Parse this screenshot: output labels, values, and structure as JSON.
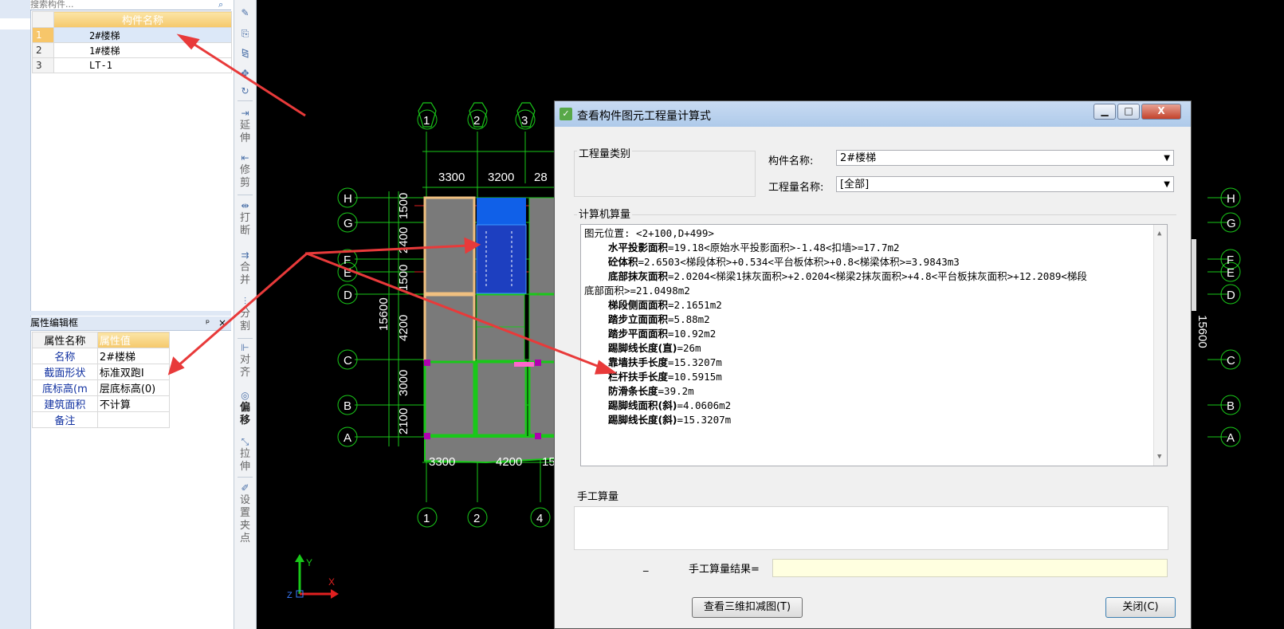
{
  "left_panel": {
    "search_placeholder": "搜索构件...",
    "component_table": {
      "header": "构件名称",
      "rows": [
        {
          "num": "1",
          "name": "2#楼梯",
          "selected": true
        },
        {
          "num": "2",
          "name": "1#楼梯",
          "selected": false
        },
        {
          "num": "3",
          "name": "LT-1",
          "selected": false
        }
      ]
    },
    "property_panel": {
      "title": "属性编辑框",
      "pin": "ᵖ",
      "close": "×",
      "header_name": "属性名称",
      "header_value": "属性值",
      "rows": [
        {
          "key": "名称",
          "value": "2#楼梯"
        },
        {
          "key": "截面形状",
          "value": "标准双跑I"
        },
        {
          "key": "底标高(m",
          "value": "层底标高(0)"
        },
        {
          "key": "建筑面积",
          "value": "不计算"
        },
        {
          "key": "备注",
          "value": ""
        }
      ]
    }
  },
  "toolbar": {
    "extend": "延伸",
    "trim": "修剪",
    "break": "打断",
    "merge": "合并",
    "split": "分割",
    "align": "对齐",
    "offset": "偏移",
    "stretch": "拉伸",
    "grip": "设置夹点"
  },
  "cad": {
    "axis_top": [
      "1",
      "2",
      "3"
    ],
    "axis_bottom": [
      "1",
      "2",
      "4"
    ],
    "axis_left": [
      "H",
      "G",
      "F",
      "E",
      "D",
      "C",
      "B",
      "A"
    ],
    "axis_right": [
      "H",
      "G",
      "F",
      "E",
      "D",
      "C",
      "B",
      "A"
    ],
    "dim_top": [
      "3300",
      "3200",
      "28"
    ],
    "dim_bottom": [
      "3300",
      "4200",
      "15"
    ],
    "dim_left_total": "15600",
    "dim_right_total": "15600",
    "dim_left": [
      "1500",
      "2400",
      "1500",
      "4200",
      "3000",
      "2100"
    ],
    "ucs_y": "Y",
    "ucs_x": "X",
    "ucs_z": "Z"
  },
  "dialog": {
    "title": "查看构件图元工程量计算式",
    "window_buttons": {
      "minimize": "▁",
      "maximize": "□",
      "close": "X"
    },
    "quantity_type_label": "工程量类别",
    "component_name_label": "构件名称:",
    "component_name_value": "2#楼梯",
    "quantity_name_label": "工程量名称:",
    "quantity_name_value": "[全部]",
    "computer_calc_label": "计算机算量",
    "calc_lines": [
      {
        "indent": false,
        "term": "",
        "text": "图元位置: <2+100,D+499>"
      },
      {
        "indent": true,
        "term": "水平投影面积",
        "text": "=19.18<原始水平投影面积>-1.48<扣墙>=17.7m2"
      },
      {
        "indent": true,
        "term": "砼体积",
        "text": "=2.6503<梯段体积>+0.534<平台板体积>+0.8<梯梁体积>=3.9843m3"
      },
      {
        "indent": true,
        "term": "底部抹灰面积",
        "text": "=2.0204<梯梁1抹灰面积>+2.0204<梯梁2抹灰面积>+4.8<平台板抹灰面积>+12.2089<梯段"
      },
      {
        "indent": false,
        "term": "",
        "text": "底部面积>=21.0498m2"
      },
      {
        "indent": true,
        "term": "梯段侧面面积",
        "text": "=2.1651m2"
      },
      {
        "indent": true,
        "term": "踏步立面面积",
        "text": "=5.88m2"
      },
      {
        "indent": true,
        "term": "踏步平面面积",
        "text": "=10.92m2"
      },
      {
        "indent": true,
        "term": "踢脚线长度(直)",
        "text": "=26m"
      },
      {
        "indent": true,
        "term": "靠墙扶手长度",
        "text": "=15.3207m"
      },
      {
        "indent": true,
        "term": "栏杆扶手长度",
        "text": "=10.5915m"
      },
      {
        "indent": true,
        "term": "防滑条长度",
        "text": "=39.2m"
      },
      {
        "indent": true,
        "term": "踢脚线面积(斜)",
        "text": "=4.0606m2"
      },
      {
        "indent": true,
        "term": "踢脚线长度(斜)",
        "text": "=15.3207m"
      }
    ],
    "manual_calc_label": "手工算量",
    "manual_underscore": "_",
    "manual_result_label": "手工算量结果=",
    "btn_view_3d": "查看三维扣减图(T)",
    "btn_close": "关闭(C)"
  }
}
